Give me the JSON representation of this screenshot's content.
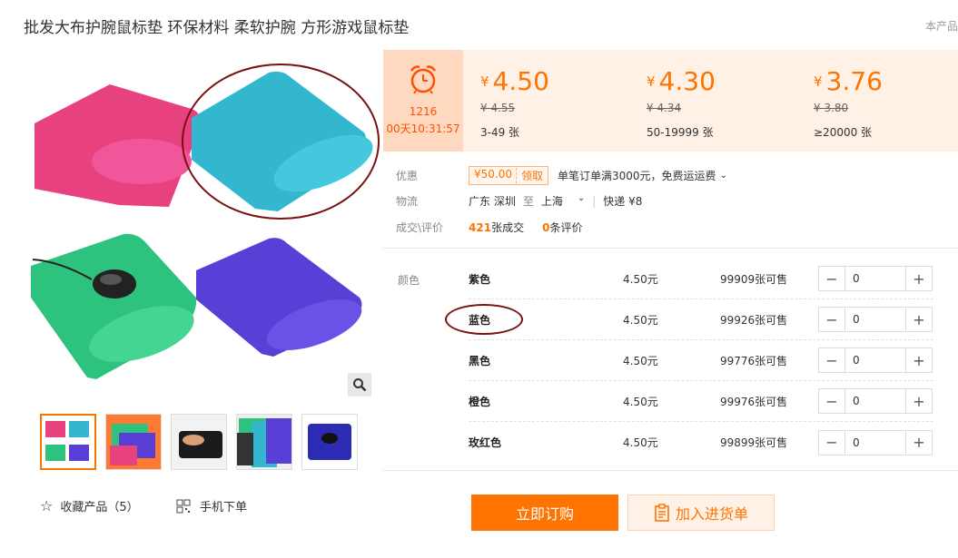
{
  "product": {
    "title": "批发大布护腕鼠标垫 环保材料 柔软护腕 方形游戏鼠标垫",
    "corner_text": "本产品"
  },
  "gallery": {
    "zoom_icon": "search-icon",
    "thumbnail_count": 5
  },
  "actions": {
    "favorite_label": "收藏产品（5）",
    "mobile_label": "手机下单"
  },
  "timer": {
    "icon": "alarm-clock-icon",
    "line1": "1216",
    "line2": "00天10:31:57"
  },
  "price_tiers": [
    {
      "currency": "¥",
      "price": "4.50",
      "original": "¥ 4.55",
      "range": "3-49 张"
    },
    {
      "currency": "¥",
      "price": "4.30",
      "original": "¥ 4.34",
      "range": "50-19999 张"
    },
    {
      "currency": "¥",
      "price": "3.76",
      "original": "¥ 3.80",
      "range": "≥20000 张"
    }
  ],
  "promo": {
    "label": "优惠",
    "coupon_amount": "¥50.00",
    "coupon_action": "领取",
    "text": "单笔订单满3000元，免费运运费"
  },
  "logistics": {
    "label": "物流",
    "origin": "广东 深圳",
    "to": "至",
    "destination": "上海",
    "shipping": "快递 ¥8"
  },
  "deals": {
    "label": "成交\\评价",
    "count": "421",
    "count_unit": "张成交",
    "reviews": "0",
    "reviews_unit": "条评价"
  },
  "sku": {
    "label": "颜色",
    "rows": [
      {
        "name": "紫色",
        "price": "4.50元",
        "stock": "99909张可售",
        "qty": "0"
      },
      {
        "name": "蓝色",
        "price": "4.50元",
        "stock": "99926张可售",
        "qty": "0"
      },
      {
        "name": "黑色",
        "price": "4.50元",
        "stock": "99776张可售",
        "qty": "0"
      },
      {
        "name": "橙色",
        "price": "4.50元",
        "stock": "99976张可售",
        "qty": "0"
      },
      {
        "name": "玫红色",
        "price": "4.50元",
        "stock": "99899张可售",
        "qty": "0"
      }
    ]
  },
  "buttons": {
    "buy": "立即订购",
    "cart": "加入进货单"
  },
  "colors": {
    "accent": "#ff7300",
    "band": "#fff1e5",
    "annotation": "#7a1010"
  }
}
